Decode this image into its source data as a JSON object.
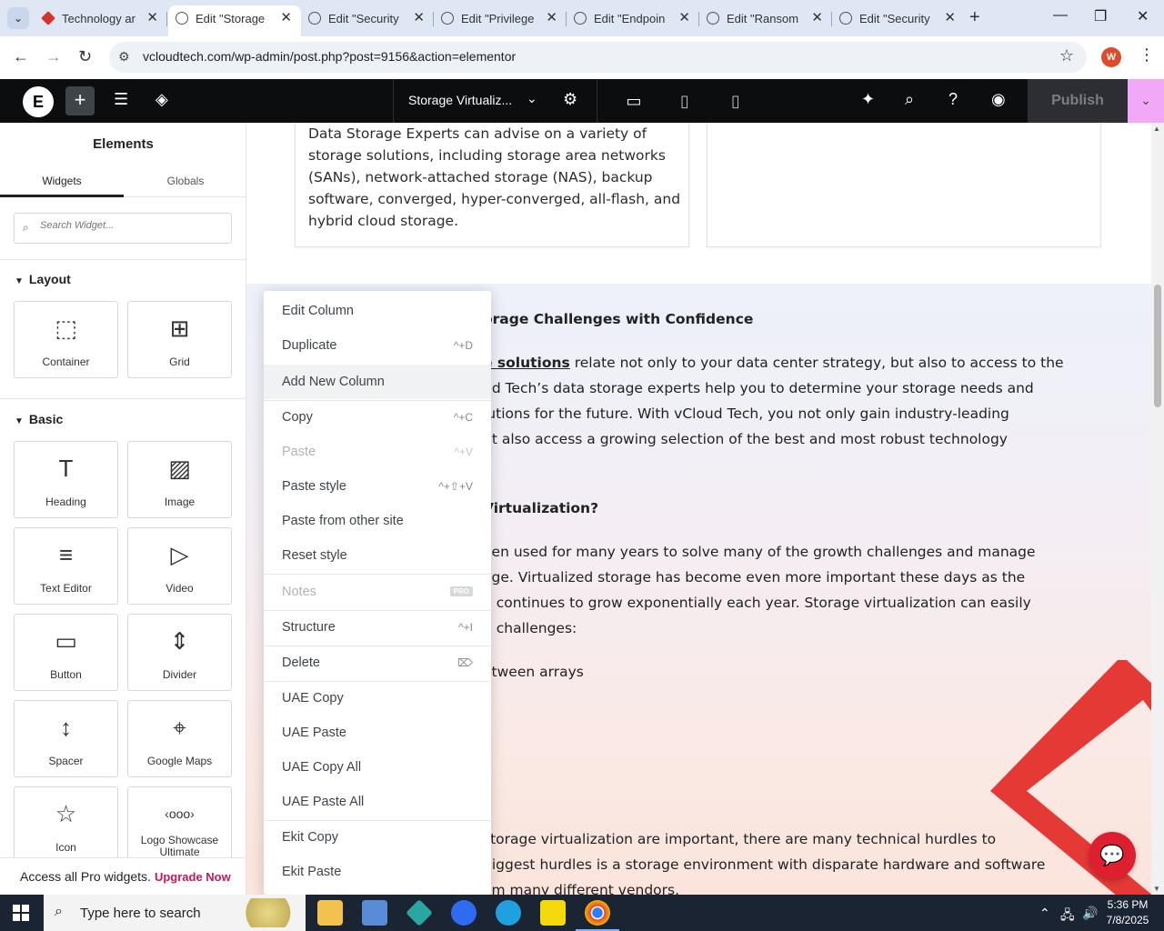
{
  "browser": {
    "tabs": [
      {
        "title": "Technology ar"
      },
      {
        "title": "Edit \"Storage"
      },
      {
        "title": "Edit \"Security"
      },
      {
        "title": "Edit \"Privilege"
      },
      {
        "title": "Edit \"Endpoin"
      },
      {
        "title": "Edit \"Ransom"
      },
      {
        "title": "Edit \"Security"
      }
    ],
    "url": "vcloudtech.com/wp-admin/post.php?post=9156&action=elementor",
    "profile_initial": "W"
  },
  "elementor": {
    "document_name": "Storage Virtualiz...",
    "publish_label": "Publish"
  },
  "panel": {
    "title": "Elements",
    "tabs": [
      "Widgets",
      "Globals"
    ],
    "search_placeholder": "Search Widget...",
    "categories": {
      "layout": "Layout",
      "basic": "Basic"
    },
    "widgets": {
      "container": "Container",
      "grid": "Grid",
      "heading": "Heading",
      "image": "Image",
      "text_editor": "Text Editor",
      "video": "Video",
      "button": "Button",
      "divider": "Divider",
      "spacer": "Spacer",
      "google_maps": "Google Maps",
      "icon": "Icon",
      "logo_showcase": "Logo Showcase Ultimate"
    },
    "promo_text": "Access all Pro widgets.",
    "promo_link": "Upgrade Now"
  },
  "canvas": {
    "card_text": "Data Storage Experts can advise on a variety of storage solutions, including storage area networks (SANs), network-attached storage (NAS), backup software, converged, hyper-converged, all-flash, and hybrid cloud storage.",
    "heading1": "orage Challenges with Confidence",
    "p1_link": "e solutions",
    "p1_l1_rest": " relate not only to your data center strategy, but also to access to the",
    "p1_l2": "ud Tech’s data storage experts help you to determine your storage needs and",
    "p1_l3": "lutions for the future. With vCloud Tech, you not only gain industry-leading",
    "p1_l4": "ut also access a growing selection of the best and most robust technology",
    "heading2": " Virtualization?",
    "p2_l1": "een used for many years to solve many of the growth challenges and manage",
    "p2_l2": "age. Virtualized storage has become even more important these days as the",
    "p2_l3": "d continues to grow exponentially each year. Storage virtualization can easily",
    "p2_l4": "n challenges:",
    "p2_l5": "etween arrays",
    "p3_l1": "storage virtualization are important, there are many technical hurdles to",
    "p3_l2": "biggest hurdles is a storage environment with disparate hardware and software",
    "p3_l3": "om many different vendors."
  },
  "context_menu": {
    "edit_column": "Edit Column",
    "duplicate": "Duplicate",
    "duplicate_sc": "^+D",
    "add_new_column": "Add New Column",
    "copy": "Copy",
    "copy_sc": "^+C",
    "paste": "Paste",
    "paste_sc": "^+V",
    "paste_style": "Paste style",
    "paste_style_sc": "^+⇧+V",
    "paste_other": "Paste from other site",
    "reset_style": "Reset style",
    "notes": "Notes",
    "notes_badge": "PRO",
    "structure": "Structure",
    "structure_sc": "^+I",
    "delete": "Delete",
    "delete_sc": "⌦",
    "uae_copy": "UAE Copy",
    "uae_paste": "UAE Paste",
    "uae_copy_all": "UAE Copy All",
    "uae_paste_all": "UAE Paste All",
    "ekit_copy": "Ekit Copy",
    "ekit_paste": "Ekit Paste"
  },
  "taskbar": {
    "search_placeholder": "Type here to search",
    "time": "5:36 PM",
    "date": "7/8/2025"
  },
  "colors": {
    "elementor_bar": "#0c0d0e",
    "publish_dropdown": "#f0a8f7",
    "accent_red": "#dd1f2f",
    "upgrade_link": "#c2185b"
  }
}
